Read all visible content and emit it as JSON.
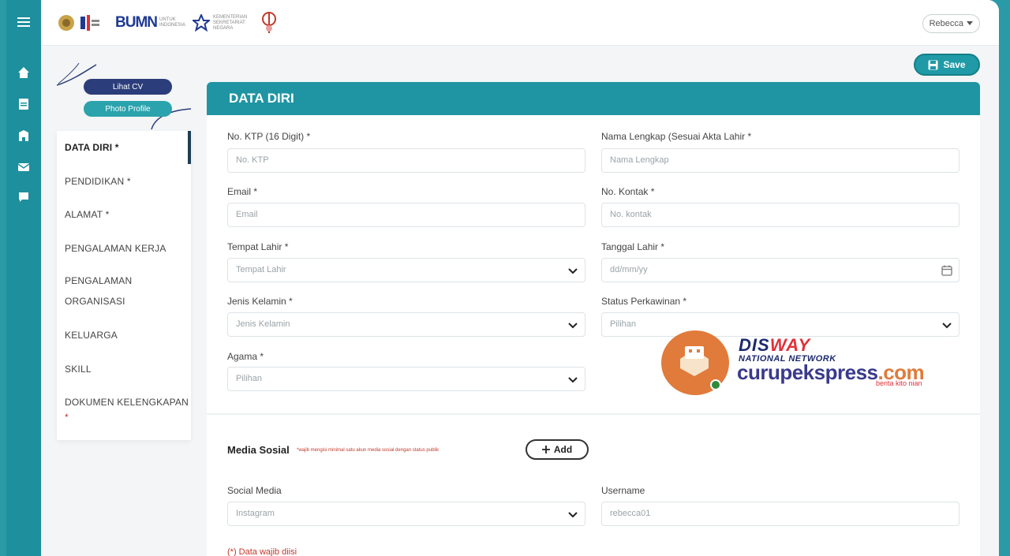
{
  "topbar": {
    "logos": {
      "bumn": "BUMN",
      "bumn_sub": "UNTUK INDONESIA",
      "kemenpora_sub": "KEMENTERIAN SEKRETARIAT NEGARA",
      "other_sub": ""
    },
    "user_menu": "Rebecca"
  },
  "actions": {
    "save_label": "Save"
  },
  "sidebar": {
    "lihat_cv": "Lihat CV",
    "photo_profile": "Photo Profile",
    "items": [
      {
        "label": "DATA DIRI *",
        "active": true
      },
      {
        "label": "PENDIDIKAN *"
      },
      {
        "label": "ALAMAT *"
      },
      {
        "label": "PENGALAMAN KERJA"
      },
      {
        "label": "PENGALAMAN"
      },
      {
        "label": "ORGANISASI"
      },
      {
        "label": "KELUARGA"
      },
      {
        "label": "SKILL"
      },
      {
        "label": "DOKUMEN KELENGKAPAN"
      },
      {
        "label": "*"
      }
    ]
  },
  "form": {
    "title": "DATA DIRI",
    "fields": {
      "ktp": {
        "label": "No. KTP (16 Digit) *",
        "placeholder": "No. KTP"
      },
      "nama": {
        "label": "Nama Lengkap (Sesuai Akta Lahir *",
        "placeholder": "Nama Lengkap"
      },
      "email": {
        "label": "Email *",
        "placeholder": "Email"
      },
      "kontak": {
        "label": "No. Kontak *",
        "placeholder": "No. kontak"
      },
      "tempat_lahir": {
        "label": "Tempat Lahir *",
        "placeholder": "Tempat Lahir"
      },
      "tanggal_lahir": {
        "label": "Tanggal Lahir *",
        "placeholder": "dd/mm/yy"
      },
      "jenis_kelamin": {
        "label": "Jenis Kelamin *",
        "placeholder": "Jenis Kelamin"
      },
      "status": {
        "label": "Status Perkawinan *",
        "placeholder": "Pilihan"
      },
      "agama": {
        "label": "Agama *",
        "placeholder": "Pilihan"
      }
    },
    "media_sosial": {
      "title": "Media Sosial",
      "note": "*wajib mengisi minimal satu akun media sosial dengan status publik",
      "add_label": "Add",
      "social_label": "Social Media",
      "social_value": "Instagram",
      "username_label": "Username",
      "username_value": "rebecca01"
    },
    "required_note": "(*) Data wajib diisi"
  },
  "watermark": {
    "brand_a": "DIS",
    "brand_b": "WAY",
    "network": "NATIONAL NETWORK",
    "site": "curupekspress",
    "tld": ".com",
    "tagline": "berita kito nian"
  },
  "colors": {
    "teal": "#1f95a3",
    "navy": "#2b3d7a",
    "accent": "#e07b3b"
  }
}
